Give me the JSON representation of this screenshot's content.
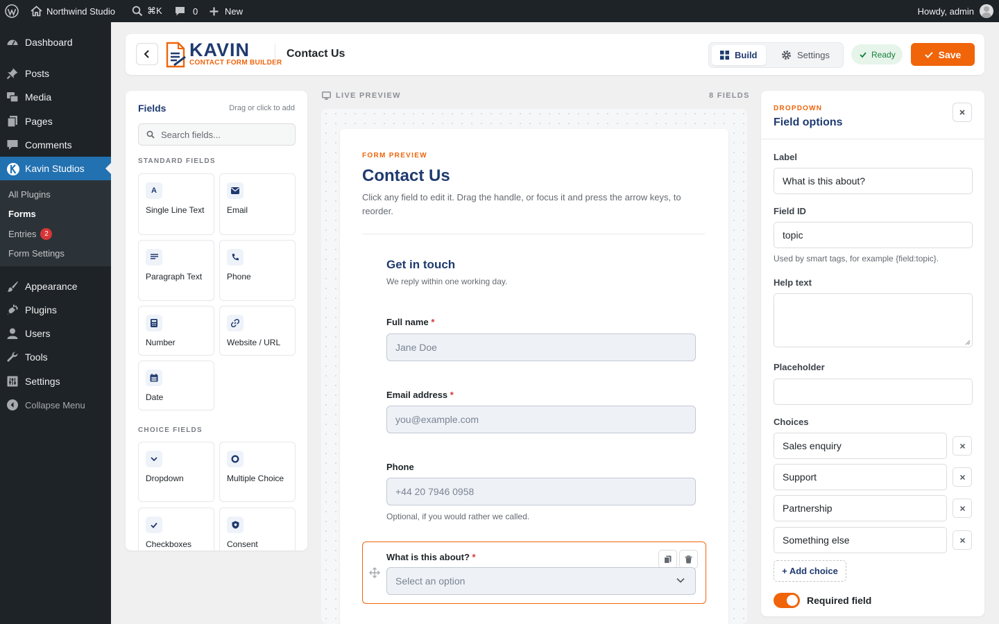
{
  "adminbar": {
    "site_name": "Northwind Studio",
    "search_shortcut": "⌘K",
    "comments_count": "0",
    "new_label": "New",
    "howdy": "Howdy, admin"
  },
  "sidebar": {
    "dashboard": "Dashboard",
    "posts": "Posts",
    "media": "Media",
    "pages": "Pages",
    "comments": "Comments",
    "kavin": "Kavin Studios",
    "sub": {
      "all_plugins": "All Plugins",
      "forms": "Forms",
      "entries": "Entries",
      "entries_badge": "2",
      "form_settings": "Form Settings"
    },
    "appearance": "Appearance",
    "plugins": "Plugins",
    "users": "Users",
    "tools": "Tools",
    "settings": "Settings",
    "collapse": "Collapse Menu"
  },
  "header": {
    "logo_main": "KAVIN",
    "logo_sub": "CONTACT FORM BUILDER",
    "title": "Contact Us",
    "build": "Build",
    "settings": "Settings",
    "ready": "Ready",
    "save": "Save"
  },
  "fields_panel": {
    "title": "Fields",
    "hint": "Drag or click to add",
    "search_placeholder": "Search fields...",
    "standard_heading": "STANDARD FIELDS",
    "standard": [
      {
        "label": "Single Line Text",
        "glyph": "A"
      },
      {
        "label": "Email"
      },
      {
        "label": "Paragraph Text"
      },
      {
        "label": "Phone"
      },
      {
        "label": "Number"
      },
      {
        "label": "Website / URL"
      },
      {
        "label": "Date"
      }
    ],
    "choice_heading": "CHOICE FIELDS",
    "choice": [
      {
        "label": "Dropdown"
      },
      {
        "label": "Multiple Choice"
      },
      {
        "label": "Checkboxes"
      },
      {
        "label": "Consent"
      }
    ]
  },
  "preview": {
    "label": "LIVE PREVIEW",
    "count": "8 FIELDS",
    "eyebrow": "FORM PREVIEW",
    "title": "Contact Us",
    "description": "Click any field to edit it. Drag the handle, or focus it and press the arrow keys, to reorder.",
    "group_title": "Get in touch",
    "group_sub": "We reply within one working day.",
    "required_mark": "*",
    "full_name": {
      "label": "Full name",
      "placeholder": "Jane Doe"
    },
    "email": {
      "label": "Email address",
      "placeholder": "you@example.com"
    },
    "phone": {
      "label": "Phone",
      "placeholder": "+44 20 7946 0958",
      "help": "Optional, if you would rather we called."
    },
    "topic": {
      "label": "What is this about?",
      "placeholder": "Select an option"
    }
  },
  "options": {
    "eyebrow": "DROPDOWN",
    "title": "Field options",
    "label_label": "Label",
    "label_value": "What is this about?",
    "fieldid_label": "Field ID",
    "fieldid_value": "topic",
    "fieldid_help": "Used by smart tags, for example {field:topic}.",
    "help_label": "Help text",
    "help_value": "",
    "placeholder_label": "Placeholder",
    "placeholder_value": "",
    "choices_label": "Choices",
    "choices": [
      "Sales enquiry",
      "Support",
      "Partnership",
      "Something else"
    ],
    "add_choice": "+ Add choice",
    "required_label": "Required field",
    "required_on": true
  },
  "colors": {
    "accent": "#f0640a",
    "brand_navy": "#1e3a6f",
    "wp_blue": "#2271b1",
    "admin_dark": "#1d2327",
    "ready_green": "#16803c"
  }
}
